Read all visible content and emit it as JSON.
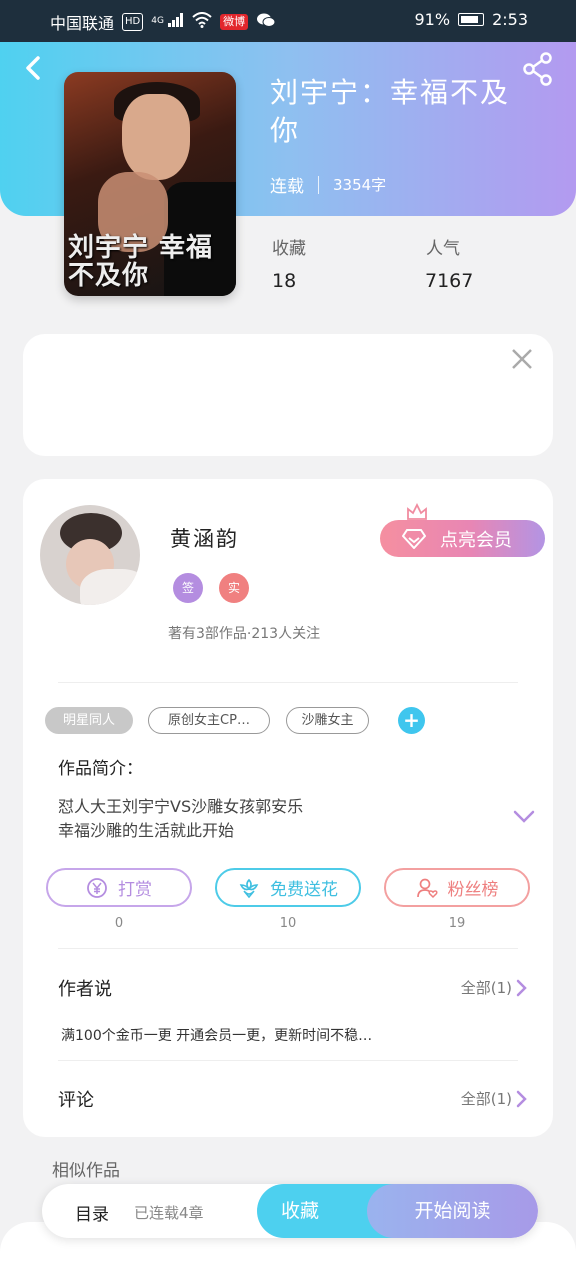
{
  "status_bar": {
    "carrier": "中国联通",
    "hd": "HD",
    "network": "4G",
    "weibo": "微博",
    "battery_percent": "91%",
    "battery_level": 0.91,
    "time": "2:53"
  },
  "header": {
    "back_icon": "chevron-left-icon",
    "share_icon": "share-icon"
  },
  "book": {
    "title": "刘宇宁：幸福不及你",
    "cover_text": "刘宇宁 幸福不及你",
    "status": "连载",
    "word_count": "3354字",
    "stats": [
      {
        "label": "收藏",
        "value": "18"
      },
      {
        "label": "人气",
        "value": "7167"
      }
    ]
  },
  "ad": {
    "close_icon": "close-icon"
  },
  "author": {
    "name": "黄涵韵",
    "badges": [
      {
        "text": "签",
        "color": "#b48de0"
      },
      {
        "text": "实",
        "color": "#f08080"
      }
    ],
    "stats_text": "著有3部作品·213人关注",
    "member_button": "点亮会员"
  },
  "tags": [
    "明星同人",
    "原创女主CP…",
    "沙雕女主"
  ],
  "intro": {
    "label": "作品简介：",
    "lines": [
      "怼人大王刘宇宁VS沙雕女孩郭安乐",
      "幸福沙雕的生活就此开始"
    ]
  },
  "actions": [
    {
      "label": "打赏",
      "count": "0",
      "color": "#b48de0"
    },
    {
      "label": "免费送花",
      "count": "10",
      "color": "#4dcbe8"
    },
    {
      "label": "粉丝榜",
      "count": "19",
      "color": "#f07f7f"
    }
  ],
  "author_says": {
    "title": "作者说",
    "all": "全部(1)",
    "text": "满100个金币一更 开通会员一更，更新时间不稳…"
  },
  "comments": {
    "title": "评论",
    "all": "全部(1)"
  },
  "similar": {
    "title": "相似作品"
  },
  "bottom_bar": {
    "toc": "目录",
    "serial": "已连载4章",
    "collect": "收藏",
    "read": "开始阅读"
  }
}
